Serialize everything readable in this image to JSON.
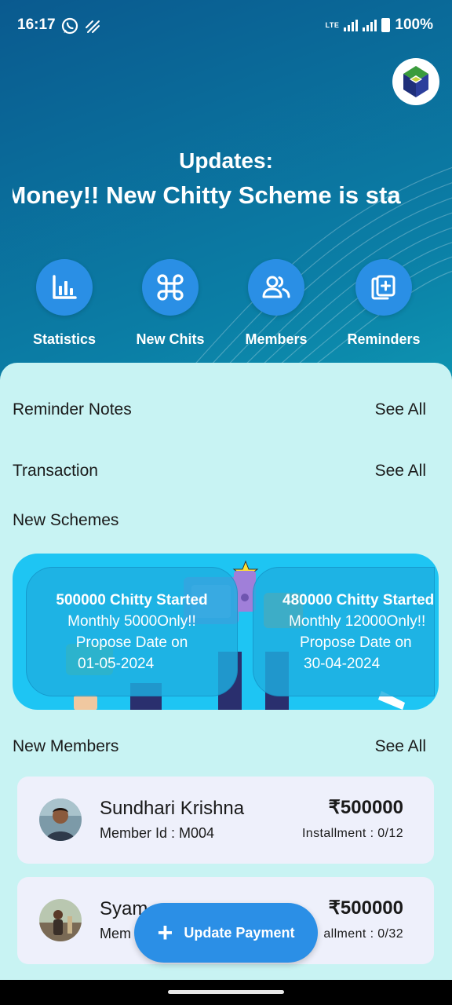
{
  "status_bar": {
    "time": "16:17",
    "network": "LTE",
    "battery": "100%",
    "icons": [
      "whatsapp-icon",
      "sim-icon",
      "signal-icon",
      "battery-icon"
    ]
  },
  "header": {
    "updates_title": "Updates:",
    "marquee_text": "g Money!!   New Chitty Scheme is sta"
  },
  "quick_actions": [
    {
      "label": "Statistics",
      "icon": "bar-chart-icon"
    },
    {
      "label": "New Chits",
      "icon": "command-icon"
    },
    {
      "label": "Members",
      "icon": "people-icon"
    },
    {
      "label": "Reminders",
      "icon": "add-note-icon"
    }
  ],
  "sections": {
    "reminder_notes": "Reminder Notes",
    "transaction": "Transaction",
    "new_schemes": "New Schemes",
    "new_members": "New Members",
    "see_all": "See All"
  },
  "schemes": [
    {
      "title": "500000 Chitty Started",
      "line2": "Monthly 5000Only!!",
      "line3": "Propose Date on",
      "date": "01-05-2024"
    },
    {
      "title": "480000 Chitty Started",
      "line2": "Monthly 12000Only!!",
      "line3": "Propose Date on",
      "date": "30-04-2024"
    }
  ],
  "members": [
    {
      "name": "Sundhari Krishna",
      "member_id": "Member Id : M004",
      "amount": "₹500000",
      "installment": "Installment : 0/12"
    },
    {
      "name": "Syam ",
      "member_id": "Mem",
      "amount": "₹500000",
      "installment": "allment : 0/32"
    }
  ],
  "fab": {
    "label": "Update Payment",
    "icon": "plus-icon"
  },
  "colors": {
    "accent": "#2b8fe6",
    "panel": "#c8f3f3",
    "banner": "#1ec5f3",
    "card": "#eef0fb"
  }
}
